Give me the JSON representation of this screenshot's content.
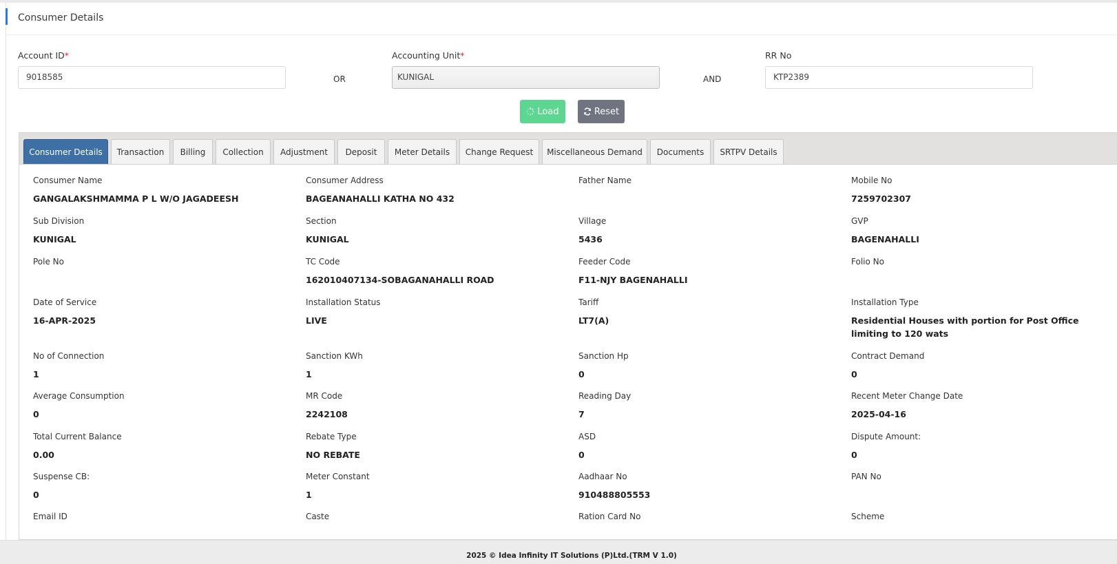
{
  "page": {
    "title": "Consumer Details"
  },
  "search": {
    "account_id": {
      "label": "Account ID",
      "required_mark": "*",
      "value": "9018585"
    },
    "or_text": "OR",
    "accounting_unit": {
      "label": "Accounting Unit",
      "required_mark": "*",
      "value": "KUNIGAL"
    },
    "and_text": "AND",
    "rr_no": {
      "label": "RR No",
      "value": "KTP2389"
    },
    "load_label": "Load",
    "reset_label": "Reset"
  },
  "tabs": [
    {
      "label": "Consumer Details",
      "active": true
    },
    {
      "label": "Transaction"
    },
    {
      "label": "Billing"
    },
    {
      "label": "Collection"
    },
    {
      "label": "Adjustment"
    },
    {
      "label": "Deposit"
    },
    {
      "label": "Meter Details"
    },
    {
      "label": "Change Request"
    },
    {
      "label": "Miscellaneous Demand"
    },
    {
      "label": "Documents"
    },
    {
      "label": "SRTPV Details"
    }
  ],
  "details": [
    {
      "label": "Consumer Name",
      "value": "GANGALAKSHMAMMA P L W/O JAGADEESH"
    },
    {
      "label": "Consumer Address",
      "value": "BAGEANAHALLI KATHA NO 432"
    },
    {
      "label": "Father Name",
      "value": ""
    },
    {
      "label": "Mobile No",
      "value": "7259702307"
    },
    {
      "label": "Sub Division",
      "value": "KUNIGAL"
    },
    {
      "label": "Section",
      "value": "KUNIGAL"
    },
    {
      "label": "Village",
      "value": "5436"
    },
    {
      "label": "GVP",
      "value": "BAGENAHALLI"
    },
    {
      "label": "Pole No",
      "value": ""
    },
    {
      "label": "TC Code",
      "value": "162010407134-SOBAGANAHALLI ROAD"
    },
    {
      "label": "Feeder Code",
      "value": "F11-NJY BAGENAHALLI"
    },
    {
      "label": "Folio No",
      "value": ""
    },
    {
      "label": "Date of Service",
      "value": "16-APR-2025"
    },
    {
      "label": "Installation Status",
      "value": "LIVE"
    },
    {
      "label": "Tariff",
      "value": "LT7(A)"
    },
    {
      "label": "Installation Type",
      "value": "Residential Houses with portion for Post Office limiting to 120 wats"
    },
    {
      "label": "No of Connection",
      "value": "1"
    },
    {
      "label": "Sanction KWh",
      "value": "1"
    },
    {
      "label": "Sanction Hp",
      "value": "0"
    },
    {
      "label": "Contract Demand",
      "value": "0"
    },
    {
      "label": "Average Consumption",
      "value": "0"
    },
    {
      "label": "MR Code",
      "value": "2242108"
    },
    {
      "label": "Reading Day",
      "value": "7"
    },
    {
      "label": "Recent Meter Change Date",
      "value": "2025-04-16"
    },
    {
      "label": "Total Current Balance",
      "value": "0.00"
    },
    {
      "label": "Rebate Type",
      "value": "NO REBATE"
    },
    {
      "label": "ASD",
      "value": "0"
    },
    {
      "label": "Dispute Amount:",
      "value": "0"
    },
    {
      "label": "Suspense CB:",
      "value": "0"
    },
    {
      "label": "Meter Constant",
      "value": "1"
    },
    {
      "label": "Aadhaar No",
      "value": "910488805553"
    },
    {
      "label": "PAN No",
      "value": ""
    },
    {
      "label": "Email ID",
      "value": ""
    },
    {
      "label": "Caste",
      "value": ""
    },
    {
      "label": "Ration Card No",
      "value": ""
    },
    {
      "label": "Scheme",
      "value": ""
    }
  ],
  "footer": {
    "text": "2025 © Idea Infinity IT Solutions (P)Ltd.(TRM V 1.0)"
  }
}
